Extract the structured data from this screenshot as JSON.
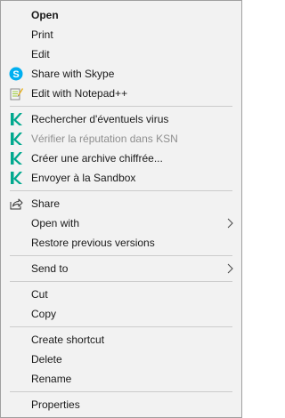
{
  "menu": {
    "groups": [
      [
        {
          "label": "Open",
          "bold": true
        },
        {
          "label": "Print"
        },
        {
          "label": "Edit"
        },
        {
          "label": "Share with Skype",
          "icon": "skype-icon"
        },
        {
          "label": "Edit with Notepad++",
          "icon": "notepad-plus-plus-icon"
        }
      ],
      [
        {
          "label": "Rechercher d'éventuels virus",
          "icon": "kaspersky-icon"
        },
        {
          "label": "Vérifier la réputation dans KSN",
          "icon": "kaspersky-icon",
          "disabled": true
        },
        {
          "label": "Créer une archive chiffrée...",
          "icon": "kaspersky-icon"
        },
        {
          "label": "Envoyer à la Sandbox",
          "icon": "kaspersky-icon"
        }
      ],
      [
        {
          "label": "Share",
          "icon": "share-icon"
        },
        {
          "label": "Open with",
          "submenu": true
        },
        {
          "label": "Restore previous versions"
        }
      ],
      [
        {
          "label": "Send to",
          "submenu": true
        }
      ],
      [
        {
          "label": "Cut"
        },
        {
          "label": "Copy"
        }
      ],
      [
        {
          "label": "Create shortcut"
        },
        {
          "label": "Delete"
        },
        {
          "label": "Rename"
        }
      ],
      [
        {
          "label": "Properties"
        }
      ]
    ]
  },
  "colors": {
    "menu_background": "#f2f2f2",
    "menu_border": "#a0a0a0",
    "text": "#1a1a1a",
    "disabled_text": "#8f8f8f",
    "separator": "#cccccc",
    "skype_blue": "#00aff0",
    "kaspersky_green": "#00a88e"
  }
}
